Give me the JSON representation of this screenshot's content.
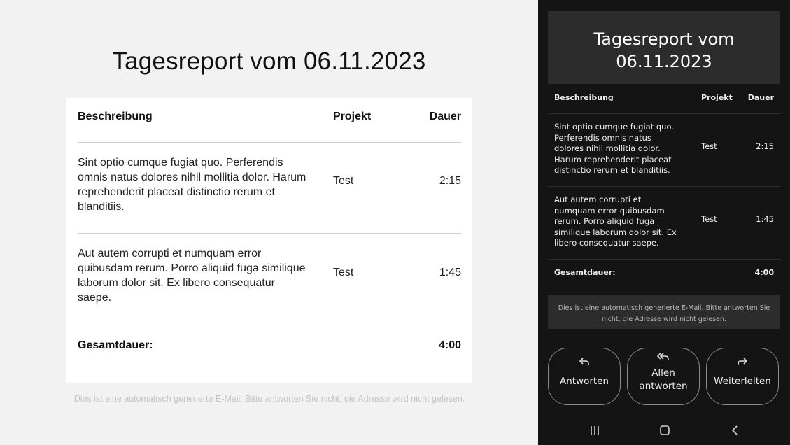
{
  "report": {
    "title": "Tagesreport vom 06.11.2023",
    "title_line1": "Tagesreport vom",
    "title_line2": "06.11.2023",
    "headers": {
      "description": "Beschreibung",
      "project": "Projekt",
      "duration": "Dauer"
    },
    "rows": [
      {
        "description": "Sint optio cumque fugiat quo. Perferendis omnis natus dolores nihil mollitia dolor. Harum reprehenderit placeat distinctio rerum et blanditiis.",
        "project": "Test",
        "duration": "2:15"
      },
      {
        "description": "Aut autem corrupti et numquam error quibusdam rerum. Porro aliquid fuga similique laborum dolor sit. Ex libero consequatur saepe.",
        "project": "Test",
        "duration": "1:45"
      }
    ],
    "total_label": "Gesamtdauer:",
    "total_value": "4:00",
    "footer": "Dies ist eine automatisch generierte E-Mail. Bitte antworten Sie nicht, die Adresse wird nicht gelesen."
  },
  "phone": {
    "actions": [
      {
        "label": "Antworten",
        "icon": "reply-icon"
      },
      {
        "label_line1": "Allen",
        "label_line2": "antworten",
        "icon": "reply-all-icon"
      },
      {
        "label": "Weiterleiten",
        "icon": "forward-icon"
      }
    ],
    "nav": [
      "recents-icon",
      "home-icon",
      "back-icon"
    ]
  },
  "colors": {
    "page_bg": "#f2f2f2",
    "card_bg": "#ffffff",
    "phone_bg": "#141414",
    "phone_panel": "#2c2c2c"
  }
}
